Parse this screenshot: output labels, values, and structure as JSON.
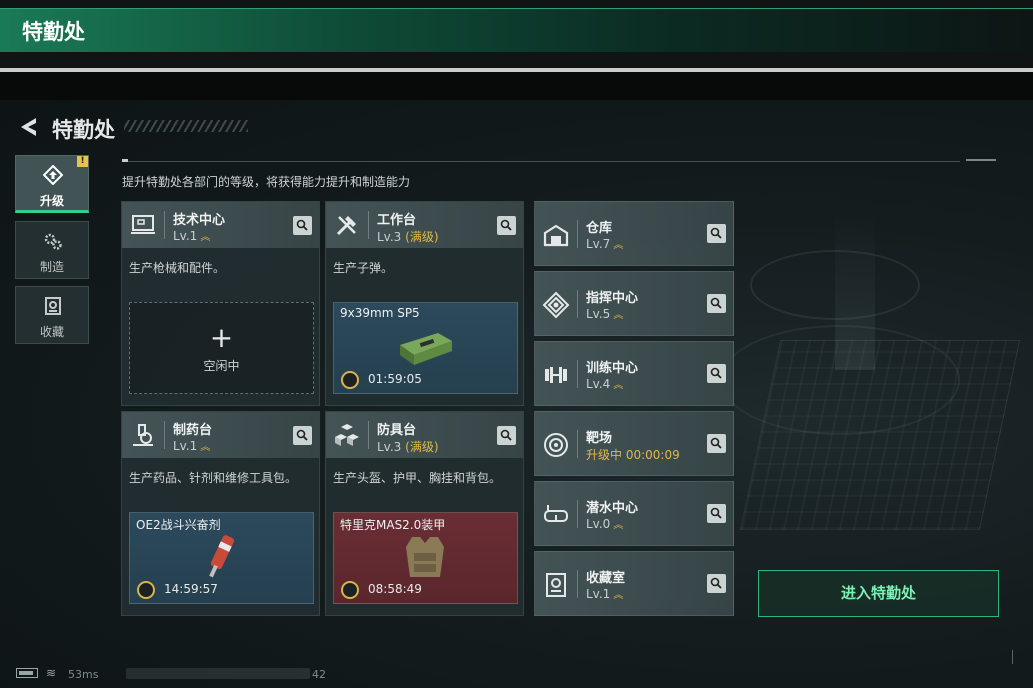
{
  "window": {
    "title": "特勤处"
  },
  "page": {
    "title": "特勤处",
    "subtitle": "提升特勤处各部门的等级，将获得能力提升和制造能力"
  },
  "tabs": [
    {
      "label": "升级",
      "icon": "upgrade-icon",
      "active": true,
      "badge": "!"
    },
    {
      "label": "制造",
      "icon": "gears-icon",
      "active": false
    },
    {
      "label": "收藏",
      "icon": "collection-icon",
      "active": false
    }
  ],
  "cards": {
    "tech_center": {
      "name": "技术中心",
      "level": "Lv.1",
      "desc": "生产枪械和配件。",
      "slot_state": "idle",
      "idle_label": "空闲中",
      "idle_symbol": "+"
    },
    "workbench": {
      "name": "工作台",
      "level": "Lv.3",
      "max_tag": "(满级)",
      "desc": "生产子弹。",
      "slot_item": "9x39mm SP5",
      "timer": "01:59:05"
    },
    "pharmacy": {
      "name": "制药台",
      "level": "Lv.1",
      "desc": "生产药品、针剂和维修工具包。",
      "slot_item": "OE2战斗兴奋剂",
      "timer": "14:59:57"
    },
    "armor_bench": {
      "name": "防具台",
      "level": "Lv.3",
      "max_tag": "(满级)",
      "desc": "生产头盔、护甲、胸挂和背包。",
      "slot_item": "特里克MAS2.0装甲",
      "timer": "08:58:49"
    }
  },
  "departments": [
    {
      "name": "仓库",
      "status": "Lv.7",
      "upgrade_arrow": true,
      "icon": "warehouse-icon"
    },
    {
      "name": "指挥中心",
      "status": "Lv.5",
      "upgrade_arrow": true,
      "icon": "command-center-icon"
    },
    {
      "name": "训练中心",
      "status": "Lv.4",
      "upgrade_arrow": true,
      "icon": "dumbbell-icon"
    },
    {
      "name": "靶场",
      "status": "升级中 00:00:09",
      "upgrade_arrow": false,
      "icon": "target-icon"
    },
    {
      "name": "潜水中心",
      "status": "Lv.0",
      "upgrade_arrow": true,
      "icon": "diving-mask-icon"
    },
    {
      "name": "收藏室",
      "status": "Lv.1",
      "upgrade_arrow": true,
      "icon": "collection-room-icon"
    }
  ],
  "enter_button": "进入特勤处",
  "status_bar": {
    "ping": "53ms",
    "uid_tail": "42"
  },
  "colors": {
    "accent_green": "#2fd28b",
    "gold": "#e2b84a",
    "slot_blue": "#2c4a5c",
    "slot_red": "#6a2e35"
  }
}
